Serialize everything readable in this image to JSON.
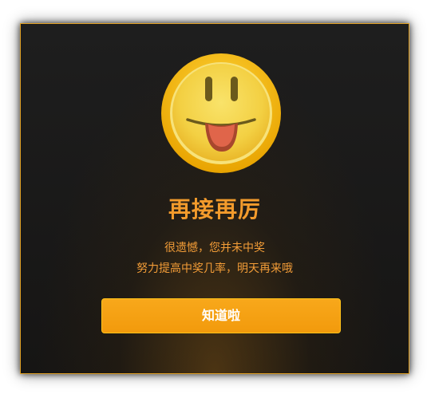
{
  "dialog": {
    "icon": "tongue-out-smiley-icon",
    "title": "再接再厉",
    "message_line1": "很遗憾，您并未中奖",
    "message_line2": "努力提高中奖几率，明天再来哦",
    "confirm_label": "知道啦"
  },
  "colors": {
    "accent": "#f39b2c",
    "button": "#f5a010",
    "border": "#e3a327",
    "background": "#1a1a1a"
  }
}
